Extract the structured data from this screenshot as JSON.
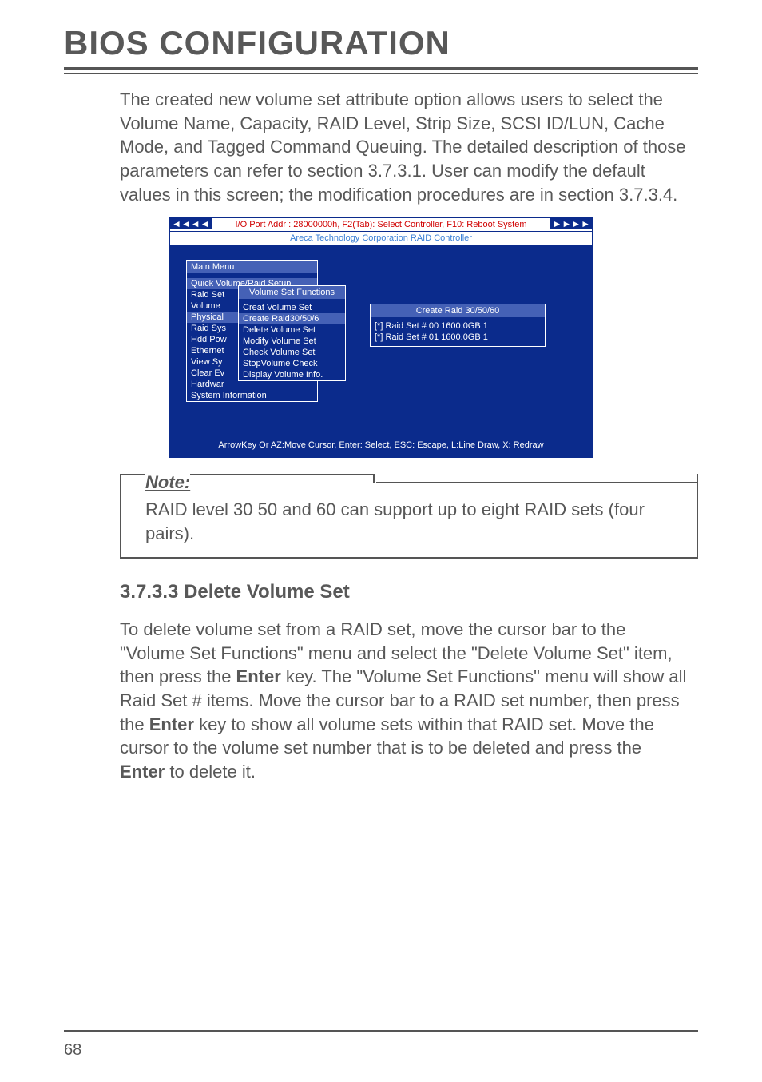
{
  "heading": "BIOS CONFIGURATION",
  "intro_paragraph": "The created new volume set attribute option allows users to select the Volume Name, Capacity, RAID Level, Strip Size, SCSI ID/LUN, Cache Mode, and Tagged Command Queuing. The detailed description of those parameters can refer to section 3.7.3.1. User can modify the default values in this screen; the modification procedures are in section 3.7.3.4.",
  "bios": {
    "arrows_left": "◄◄◄◄",
    "arrows_right": "►►►►",
    "top_line": "I/O Port Addr : 28000000h, F2(Tab): Select Controller, F10: Reboot System",
    "sub_line": "Areca Technology Corporation RAID Controller",
    "footer": "ArrowKey Or AZ:Move Cursor, Enter: Select, ESC: Escape, L:Line Draw, X: Redraw",
    "main_menu": {
      "title": "Main Menu",
      "items": [
        "Quick Volume/Raid Setup",
        "Raid Set",
        "Volume",
        "Physical",
        "Raid Sys",
        "Hdd Pow",
        "Ethernet",
        "View Sy",
        "Clear Ev",
        "Hardwar",
        "System Information"
      ]
    },
    "volume_funcs": {
      "title": "Volume Set Functions",
      "items": [
        "Creat Volume Set",
        "Create Raid30/50/6",
        "Delete Volume Set",
        "Modify Volume Set",
        "Check Volume Set",
        "StopVolume Check",
        "Display Volume Info."
      ]
    },
    "create_panel": {
      "title": "Create  Raid 30/50/60",
      "row1": "[*] Raid Set   #   00   1600.0GB  1",
      "row2": "[*] Raid Set   #   01   1600.0GB  1"
    }
  },
  "note": {
    "label": "Note:",
    "text": "RAID level 30 50 and 60 can support up to eight RAID sets (four pairs)."
  },
  "subheading": "3.7.3.3 Delete Volume Set",
  "delete_paragraph": {
    "p1": "To delete volume set from a RAID set, move the cursor bar to the \"Volume Set Functions\" menu and select the \"Delete Volume Set\" item, then press the ",
    "enter1": "Enter",
    "p2": " key. The \"Volume Set Func­tions\" menu will show all Raid Set # items. Move the cursor bar to a RAID set number, then press the ",
    "enter2": "Enter",
    "p3": " key to show all volume sets within that RAID set. Move the cursor to the volume set number that is to be deleted and press the ",
    "enter3": "Enter",
    "p4": " to delete it."
  },
  "page_number": "68"
}
